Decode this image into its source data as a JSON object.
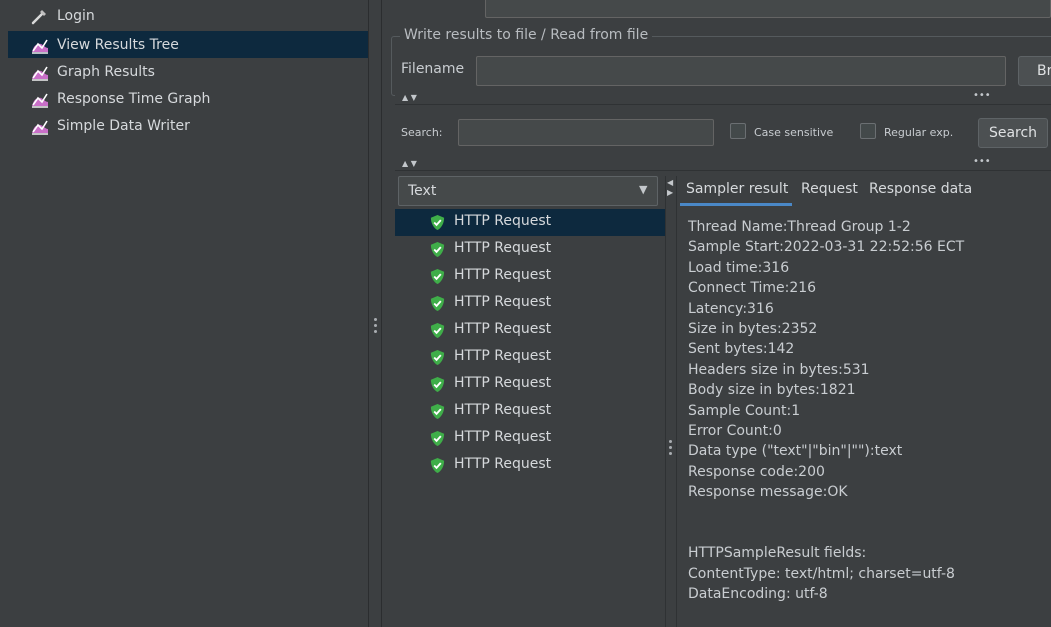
{
  "tree": {
    "items": [
      {
        "label": "Login",
        "icon": "pipette-icon"
      },
      {
        "label": "View Results Tree",
        "icon": "chart-icon",
        "selected": true
      },
      {
        "label": "Graph Results",
        "icon": "chart-icon"
      },
      {
        "label": "Response Time Graph",
        "icon": "chart-icon"
      },
      {
        "label": "Simple Data Writer",
        "icon": "chart-icon"
      }
    ]
  },
  "file_section": {
    "legend": "Write results to file / Read from file",
    "filename_label": "Filename",
    "filename_value": "",
    "browse_label": "Br"
  },
  "search": {
    "label": "Search:",
    "value": "",
    "case_sensitive_label": "Case sensitive",
    "regex_label": "Regular exp.",
    "button_label": "Search"
  },
  "renderer": {
    "selected": "Text"
  },
  "results": {
    "items": [
      "HTTP Request",
      "HTTP Request",
      "HTTP Request",
      "HTTP Request",
      "HTTP Request",
      "HTTP Request",
      "HTTP Request",
      "HTTP Request",
      "HTTP Request",
      "HTTP Request"
    ]
  },
  "tabs": [
    "Sampler result",
    "Request",
    "Response data"
  ],
  "detail": {
    "lines": [
      "Thread Name:Thread Group 1-2",
      "Sample Start:2022-03-31 22:52:56 ECT",
      "Load time:316",
      "Connect Time:216",
      "Latency:316",
      "Size in bytes:2352",
      "Sent bytes:142",
      "Headers size in bytes:531",
      "Body size in bytes:1821",
      "Sample Count:1",
      "Error Count:0",
      "Data type (\"text\"|\"bin\"|\"\"):text",
      "Response code:200",
      "Response message:OK",
      "",
      "",
      "HTTPSampleResult fields:",
      "ContentType: text/html; charset=utf-8",
      "DataEncoding: utf-8"
    ]
  },
  "colors": {
    "background": "#3c3f41",
    "selection": "#0d293e",
    "tab_underline": "#4a88c7",
    "success": "#3fae49"
  }
}
